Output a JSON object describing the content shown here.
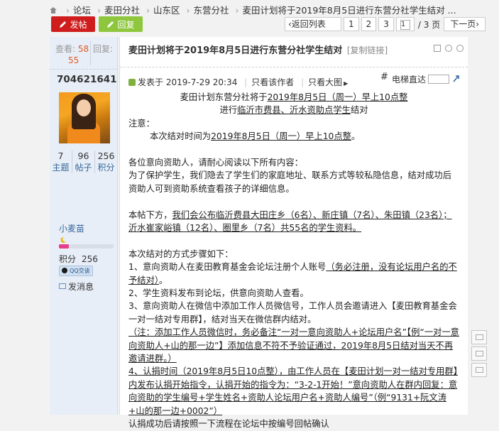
{
  "breadcrumb": [
    "论坛",
    "麦田分社",
    "山东区",
    "东营分社",
    "麦田计划将于2019年8月5日进行东营分社学生结对 ..."
  ],
  "actions": {
    "post": "发帖",
    "reply": "回复"
  },
  "pager": {
    "back": "‹返回列表",
    "pages": [
      "1",
      "2",
      "3"
    ],
    "current": "1",
    "total": "/ 3 页",
    "next": "下一页›"
  },
  "stats": {
    "views_label": "查看:",
    "views": "58",
    "replies_label": "回复:",
    "replies": "55"
  },
  "author": {
    "name": "704621641",
    "counts": [
      {
        "n": "7",
        "label": "主题"
      },
      {
        "n": "96",
        "label": "帖子"
      },
      {
        "n": "256",
        "label": "积分"
      }
    ],
    "rank": "小麦苗",
    "score_label": "积分",
    "score": "256",
    "qq": "QQ交谈",
    "message": "发消息",
    "level_fraction": 0.18
  },
  "post": {
    "title": "麦田计划将于2019年8月5日进行东营分社学生结对",
    "copy_link": "[复制链接]",
    "posted_label": "发表于",
    "posted_time": "2019-7-29 20:34",
    "only_author": "只看该作者",
    "big_image": "只看大图",
    "floor_hash": "#",
    "floor_jump": "电梯直达",
    "heading1_pre": "麦田计划东营分社将于",
    "heading1_date": "2019年8月5日（周一）早上10点整",
    "heading2_pre": "进行",
    "heading2_place": "临沂市费县、沂水资助点学生",
    "heading2_post": "结对",
    "note_label": "注意：",
    "note_line_pre": "本次结对时间为",
    "note_line_date": "2019年8月5日（周一）早上10点整",
    "note_line_post": "。",
    "intro1": "各位意向资助人，请耐心阅读以下所有内容：",
    "intro2": "为了保护学生，我们隐去了学生们的家庭地址、联系方式等较私隐信息，结对成功后资助人可到资助系统查看孩子的详细信息。",
    "list_pre": "本帖下方，",
    "list_text": "我们会公布临沂费县大田庄乡（6名）、新庄镇（7名）、朱田镇（23名）；沂水崔家峪镇（12名）、圈里乡（7名）共55名的学生资料。",
    "steps_label": "本次结对的方式步骤如下：",
    "step1_pre": "1、意向资助人在麦田教育基金会论坛注册个人账号",
    "step1_u": "（务必注册，没有论坛用户名的不予结对）",
    "step1_post": "。",
    "step2": "2、学生资料发布到论坛，供意向资助人查看。",
    "step3": "3、意向资助人在微信中添加工作人员微信号，工作人员会邀请进入【麦田教育基金会一对一结对专用群】，结对当天在微信群内结对。",
    "step3_note": "（注：添加工作人员微信时，务必备注“一对一意向资助人+论坛用户名”【例“一对一意向资助人+山的那一边”】添加信息不符不予验证通过，2019年8月5日结对当天不再邀请进群。）",
    "step4": "4、认捐时间（2019年8月5日10点整），由工作人员在【麦田计划一对一结对专用群】内发布认捐开始指令，认捐开始的指令为：“3-2-1开始！”意向资助人在群内回复：意向资助的学生编号+学生姓名+资助人论坛用户名+资助人编号”（例“9131+阮文涛+山的那一边+0002”）",
    "step5": "认捐成功后请按照一下流程在论坛中按编号回帖确认"
  }
}
